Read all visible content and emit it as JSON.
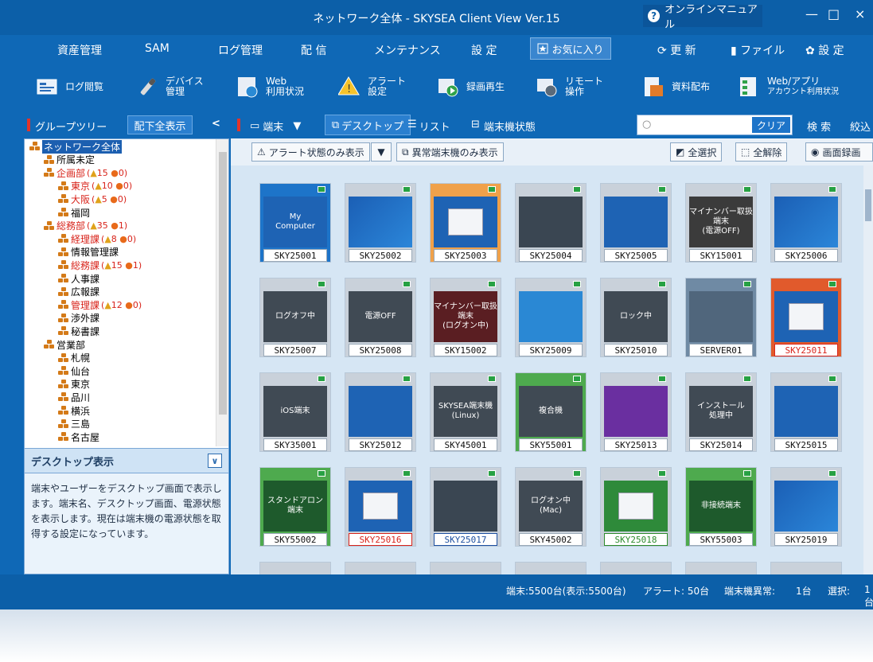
{
  "window": {
    "title": "ネットワーク全体 - SKYSEA Client View Ver.15",
    "online_manual": "オンラインマニュアル",
    "minimize": "—",
    "maximize": "□",
    "close": "×"
  },
  "menu": {
    "items": [
      "資産管理",
      "SAM",
      "ログ管理",
      "配 信",
      "メンテナンス",
      "設 定"
    ],
    "favorites": "お気に入り",
    "refresh": "更 新",
    "file": "ファイル",
    "settings": "設 定"
  },
  "toolbar": {
    "items": [
      {
        "label1": "ログ閲覧",
        "label2": "",
        "icon": "log-icon"
      },
      {
        "label1": "デバイス",
        "label2": "管理",
        "icon": "device-icon"
      },
      {
        "label1": "Web",
        "label2": "利用状況",
        "icon": "web-icon"
      },
      {
        "label1": "アラート",
        "label2": "設定",
        "icon": "alert-icon"
      },
      {
        "label1": "録画再生",
        "label2": "",
        "icon": "record-icon"
      },
      {
        "label1": "リモート",
        "label2": "操作",
        "icon": "remote-icon"
      },
      {
        "label1": "資料配布",
        "label2": "",
        "icon": "distribute-icon"
      },
      {
        "label1": "Web/アプリ",
        "label2": "アカウント利用状況",
        "icon": "account-icon"
      }
    ]
  },
  "subbar": {
    "group_tree": "グループツリー",
    "show_all": "配下全表示",
    "collapse": "<",
    "terminal": "端末",
    "desktop": "デスクトップ",
    "list": "リスト",
    "terminal_status": "端末機状態",
    "clear": "クリア",
    "search": "検 索",
    "filter": "絞込"
  },
  "tree": [
    {
      "label": "ネットワーク全体",
      "level": 0,
      "selected": true,
      "red": false
    },
    {
      "label": "所属未定",
      "level": 1,
      "red": false
    },
    {
      "label": "企画部",
      "level": 1,
      "red": true,
      "alert": "15",
      "err": "0"
    },
    {
      "label": "東京",
      "level": 2,
      "red": true,
      "alert": "10",
      "err": "0"
    },
    {
      "label": "大阪",
      "level": 2,
      "red": true,
      "alert": "5",
      "err": "0"
    },
    {
      "label": "福岡",
      "level": 2,
      "red": false
    },
    {
      "label": "総務部",
      "level": 1,
      "red": true,
      "alert": "35",
      "err": "1"
    },
    {
      "label": "経理課",
      "level": 2,
      "red": true,
      "alert": "8",
      "err": "0"
    },
    {
      "label": "情報管理課",
      "level": 2,
      "red": false
    },
    {
      "label": "総務課",
      "level": 2,
      "red": true,
      "alert": "15",
      "err": "1"
    },
    {
      "label": "人事課",
      "level": 2,
      "red": false
    },
    {
      "label": "広報課",
      "level": 2,
      "red": false
    },
    {
      "label": "管理課",
      "level": 2,
      "red": true,
      "alert": "12",
      "err": "0"
    },
    {
      "label": "渉外課",
      "level": 2,
      "red": false
    },
    {
      "label": "秘書課",
      "level": 2,
      "red": false
    },
    {
      "label": "営業部",
      "level": 1,
      "red": false
    },
    {
      "label": "札幌",
      "level": 2,
      "red": false
    },
    {
      "label": "仙台",
      "level": 2,
      "red": false
    },
    {
      "label": "東京",
      "level": 2,
      "red": false
    },
    {
      "label": "品川",
      "level": 2,
      "red": false
    },
    {
      "label": "横浜",
      "level": 2,
      "red": false
    },
    {
      "label": "三島",
      "level": 2,
      "red": false
    },
    {
      "label": "名古屋",
      "level": 2,
      "red": false
    }
  ],
  "desc": {
    "title": "デスクトップ表示",
    "body": "端末やユーザーをデスクトップ画面で表示します。端末名、デスクトップ画面、電源状態を表示します。現在は端末機の電源状態を取得する設定になっています。"
  },
  "actions": {
    "alert_only": "アラート状態のみ表示",
    "abnormal_only": "異常端末機のみ表示",
    "select_all": "全選択",
    "deselect_all": "全解除",
    "screen_record": "画面録画"
  },
  "tiles": [
    {
      "name": "SKY25001",
      "screen": "My\nComputer",
      "style": "blue",
      "frame": "#1d74c9",
      "label_style": ""
    },
    {
      "name": "SKY25002",
      "screen": "",
      "style": "win",
      "frame": "#c9d1da",
      "label_style": ""
    },
    {
      "name": "SKY25003",
      "screen": "",
      "style": "doc",
      "frame": "#f0a14a",
      "label_style": ""
    },
    {
      "name": "SKY25004",
      "screen": "",
      "style": "dark",
      "frame": "#c9d1da",
      "label_style": ""
    },
    {
      "name": "SKY25005",
      "screen": "",
      "style": "blue",
      "frame": "#c9d1da",
      "label_style": ""
    },
    {
      "name": "SKY15001",
      "screen": "マイナンバー取扱端末\n(電源OFF)",
      "style": "off",
      "frame": "#c9d1da",
      "label_style": ""
    },
    {
      "name": "SKY25006",
      "screen": "",
      "style": "win",
      "frame": "#c9d1da",
      "label_style": ""
    },
    {
      "name": "SKY25007",
      "screen": "ログオフ中",
      "style": "gray",
      "frame": "#c9d1da",
      "label_style": ""
    },
    {
      "name": "SKY25008",
      "screen": "電源OFF",
      "style": "gray",
      "frame": "#c9d1da",
      "label_style": ""
    },
    {
      "name": "SKY15002",
      "screen": "マイナンバー取扱端末\n(ログオン中)",
      "style": "maroon",
      "frame": "#c9d1da",
      "label_style": ""
    },
    {
      "name": "SKY25009",
      "screen": "",
      "style": "desk",
      "frame": "#c9d1da",
      "label_style": ""
    },
    {
      "name": "SKY25010",
      "screen": "ロック中",
      "style": "gray",
      "frame": "#c9d1da",
      "label_style": ""
    },
    {
      "name": "SERVER01",
      "screen": "",
      "style": "slate",
      "frame": "#6f8aa4",
      "label_style": ""
    },
    {
      "name": "SKY25011",
      "screen": "",
      "style": "doc",
      "frame": "#e15a2c",
      "label_style": "alert"
    },
    {
      "name": "SKY35001",
      "screen": "iOS端末",
      "style": "gray",
      "frame": "#c9d1da",
      "label_style": ""
    },
    {
      "name": "SKY25012",
      "screen": "",
      "style": "blue",
      "frame": "#c9d1da",
      "label_style": ""
    },
    {
      "name": "SKY45001",
      "screen": "SKYSEA端末機\n(Linux)",
      "style": "gray",
      "frame": "#c9d1da",
      "label_style": ""
    },
    {
      "name": "SKY55001",
      "screen": "複合機",
      "style": "gray",
      "frame": "#4eaa4e",
      "label_style": ""
    },
    {
      "name": "SKY25013",
      "screen": "",
      "style": "purple",
      "frame": "#c9d1da",
      "label_style": ""
    },
    {
      "name": "SKY25014",
      "screen": "インストール\n処理中",
      "style": "gray",
      "frame": "#c9d1da",
      "label_style": ""
    },
    {
      "name": "SKY25015",
      "screen": "",
      "style": "blue",
      "frame": "#c9d1da",
      "label_style": ""
    },
    {
      "name": "SKY55002",
      "screen": "スタンドアロン\n端末",
      "style": "green",
      "frame": "#4eaa4e",
      "label_style": ""
    },
    {
      "name": "SKY25016",
      "screen": "",
      "style": "doc",
      "frame": "#c9d1da",
      "label_style": "alert"
    },
    {
      "name": "SKY25017",
      "screen": "",
      "style": "dark",
      "frame": "#c9d1da",
      "label_style": "blue"
    },
    {
      "name": "SKY45002",
      "screen": "ログオン中\n(Mac)",
      "style": "gray",
      "frame": "#c9d1da",
      "label_style": ""
    },
    {
      "name": "SKY25018",
      "screen": "",
      "style": "greendoc",
      "frame": "#c9d1da",
      "label_style": "green"
    },
    {
      "name": "SKY55003",
      "screen": "非接続端末",
      "style": "green",
      "frame": "#4eaa4e",
      "label_style": ""
    },
    {
      "name": "SKY25019",
      "screen": "",
      "style": "win",
      "frame": "#c9d1da",
      "label_style": ""
    }
  ],
  "status": {
    "terminals": "端末:5500台(表示:5500台)",
    "alerts": "アラート: 50台",
    "abnormal_label": "端末機異常:",
    "abnormal_value": "1台",
    "selected": "選択:",
    "selected_value": "1台"
  },
  "colors": {
    "chrome": "#0f68b6",
    "accent": "#1d74c9",
    "alert": "#d8231a"
  }
}
